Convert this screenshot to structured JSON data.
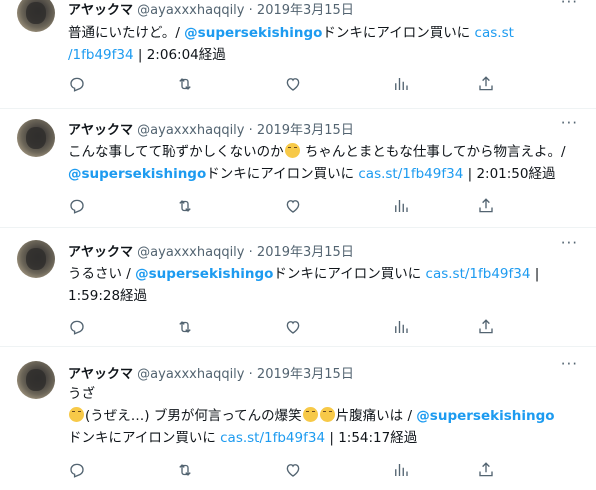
{
  "tweets": [
    {
      "name": "アヤックマ",
      "handle": "@ayaxxxhaqqily",
      "dot": "·",
      "date": "2019年3月15日",
      "line1_pre": "普通にいたけど。/ ",
      "mention": "@supersekishingo",
      "mid": "ドンキにアイロン買いに ",
      "link": "cas.st",
      "line2_link": "/1fb49f34",
      "sep": " | ",
      "elapsed": "2:06:04経過"
    },
    {
      "name": "アヤックマ",
      "handle": "@ayaxxxhaqqily",
      "dot": "·",
      "date": "2019年3月15日",
      "line1_pre": "こんな事してて恥ずかしくないのか",
      "line1_post": " ちゃんとまともな仕事してから物言えよ。/ ",
      "mention": "@supersekishingo",
      "mid": "ドンキにアイロン買いに ",
      "link": "cas.st/1fb49f34",
      "sep": " | ",
      "elapsed": "2:01:50経過"
    },
    {
      "name": "アヤックマ",
      "handle": "@ayaxxxhaqqily",
      "dot": "·",
      "date": "2019年3月15日",
      "line1_pre": "うるさい / ",
      "mention": "@supersekishingo",
      "mid": "ドンキにアイロン買いに ",
      "link": "cas.st/1fb49f34",
      "sep": " |",
      "elapsed": "1:59:28経過"
    },
    {
      "name": "アヤックマ",
      "handle": "@ayaxxxhaqqily",
      "dot": "·",
      "date": "2019年3月15日",
      "line1": "うざ",
      "line2_a": "(うぜえ…) ブ男が何言ってんの爆笑",
      "line2_b": "片腹痛いは / ",
      "mention": "@supersekishingo",
      "mid": "ドンキにアイロン買いに ",
      "link": "cas.st/1fb49f34",
      "sep": " | ",
      "elapsed": "1:54:17経過"
    }
  ],
  "icons": {
    "reply": "reply-icon",
    "retweet": "retweet-icon",
    "like": "like-icon",
    "stats": "views-icon",
    "share": "share-icon",
    "more": "more-icon"
  },
  "more_label": "···",
  "colors": {
    "link": "#1d9bf0",
    "muted": "#536471",
    "text": "#0f1419",
    "divider": "#eff3f4"
  }
}
